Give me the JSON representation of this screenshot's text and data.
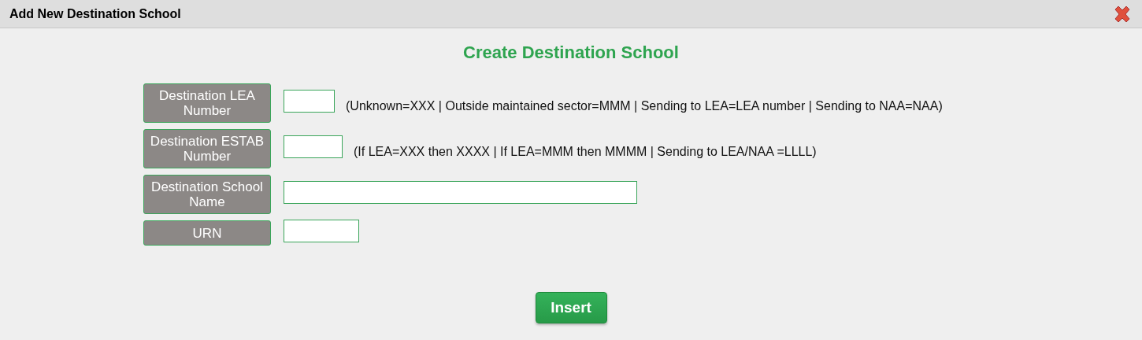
{
  "window": {
    "title": "Add New Destination School"
  },
  "heading": "Create Destination School",
  "fields": [
    {
      "label": "Destination LEA Number",
      "hint": "(Unknown=XXX | Outside maintained sector=MMM | Sending to LEA=LEA number | Sending to NAA=NAA)"
    },
    {
      "label": "Destination ESTAB Number",
      "hint": "(If LEA=XXX then XXXX | If LEA=MMM then MMMM | Sending to LEA/NAA =LLLL)"
    },
    {
      "label": "Destination School Name"
    },
    {
      "label": "URN"
    }
  ],
  "buttons": [
    "Insert"
  ]
}
